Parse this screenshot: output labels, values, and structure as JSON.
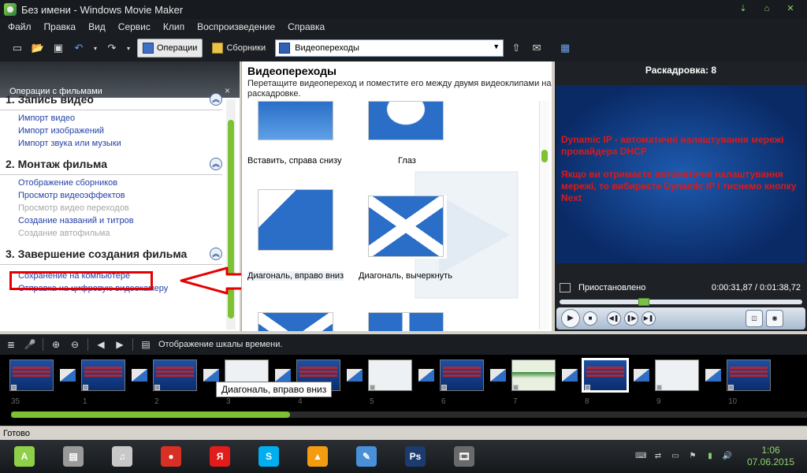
{
  "window": {
    "title": "Без имени - Windows Movie Maker",
    "controls": [
      "⇣",
      "⌂",
      "✕"
    ]
  },
  "menu": [
    "Файл",
    "Правка",
    "Вид",
    "Сервис",
    "Клип",
    "Воспроизведение",
    "Справка"
  ],
  "toolbar": {
    "operations_label": "Операции",
    "collections_label": "Сборники",
    "collection_select": "Видеопереходы"
  },
  "tasks": {
    "header": "Операции с фильмами",
    "close_glyph": "×",
    "sections": [
      {
        "title": "1. Запись видео",
        "links": [
          {
            "label": "Импорт видео",
            "enabled": true
          },
          {
            "label": "Импорт изображений",
            "enabled": true
          },
          {
            "label": "Импорт звука или музыки",
            "enabled": true
          }
        ]
      },
      {
        "title": "2. Монтаж фильма",
        "links": [
          {
            "label": "Отображение сборников",
            "enabled": true
          },
          {
            "label": "Просмотр видеоэффектов",
            "enabled": true
          },
          {
            "label": "Просмотр видео переходов",
            "enabled": false
          },
          {
            "label": "Создание названий и титров",
            "enabled": true
          },
          {
            "label": "Создание автофильма",
            "enabled": false
          }
        ]
      },
      {
        "title": "3. Завершение создания фильма",
        "links": [
          {
            "label": "Сохранение на компьютере",
            "enabled": true
          },
          {
            "label": "Отправка на цифровую видеокамеру",
            "enabled": true
          }
        ]
      }
    ]
  },
  "transitions": {
    "title": "Видеопереходы",
    "description": "Перетащите видеопереход и поместите его между двумя видеоклипами на раскадровке.",
    "items": [
      {
        "label": "Вставить, справа снизу"
      },
      {
        "label": "Глаз"
      },
      {
        "label": "Диагональ, вправо вниз"
      },
      {
        "label": "Диагональ, вычеркнуть"
      },
      {
        "label": ""
      },
      {
        "label": ""
      }
    ]
  },
  "monitor": {
    "storyboard_label": "Раскадровка: 8",
    "screen_text_1": "Dynamic IP - автоматичні налаштування мережі провайдера DHCP",
    "screen_text_2": "Якщо ви отримаєте автоматичні налаштування мережі, то вибираєте Dynamic IP і тиснемо кнопку Next",
    "status": "Приостановлено",
    "time": "0:00:31,87 / 0:01:38,72",
    "seek_position": 0.34
  },
  "storyboard": {
    "timeline_label": "Отображение шкалы времени.",
    "tooltip": "Диагональ, вправо вниз",
    "clip_numbers": [
      "35",
      "1",
      "2",
      "3",
      "4",
      "5",
      "6",
      "7",
      "8",
      "9",
      "10"
    ],
    "selected_index": 8,
    "scroll_fraction": 0.35
  },
  "statusbar": {
    "text": "Готово"
  },
  "taskbar": {
    "apps": [
      {
        "name": "android",
        "glyph": "A",
        "color": "#8ed04a"
      },
      {
        "name": "files",
        "glyph": "▤",
        "color": "#9a9a9a"
      },
      {
        "name": "music",
        "glyph": "♫",
        "color": "#c8c8c8"
      },
      {
        "name": "chrome",
        "glyph": "●",
        "color": "#d93025"
      },
      {
        "name": "yandex",
        "glyph": "Я",
        "color": "#e21b1b"
      },
      {
        "name": "skype",
        "glyph": "S",
        "color": "#00aff0"
      },
      {
        "name": "aimp",
        "glyph": "▲",
        "color": "#f39c12"
      },
      {
        "name": "paint",
        "glyph": "✎",
        "color": "#4a90d9"
      },
      {
        "name": "photoshop",
        "glyph": "Ps",
        "color": "#1c3b6f"
      },
      {
        "name": "moviemaker",
        "glyph": "🎞",
        "color": "#6a6a6a"
      }
    ],
    "time": "1:06",
    "date": "07.06.2015"
  },
  "colors": {
    "accent_green": "#7dc232",
    "highlight_red": "#e60000",
    "link_blue": "#2441a8"
  }
}
